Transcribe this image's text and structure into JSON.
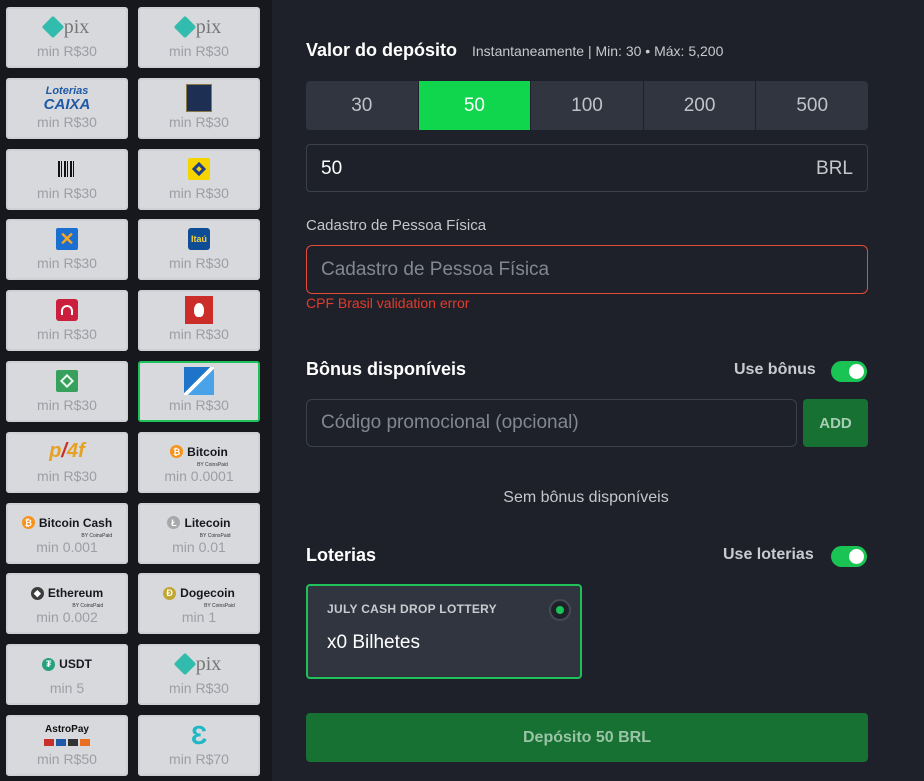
{
  "payment_methods": [
    {
      "name": "pix",
      "min": "min R$30",
      "logo": "pix-logo",
      "logo_text": "pix"
    },
    {
      "name": "pix",
      "min": "min R$30",
      "logo": "pix-logo",
      "logo_text": "pix"
    },
    {
      "name": "loterias-caixa",
      "min": "min R$30",
      "logo": "loterias-caixa-logo",
      "logo_text": "Loterias",
      "logo_text2": "CAIXA"
    },
    {
      "name": "safra",
      "min": "min R$30",
      "logo": "safra-logo"
    },
    {
      "name": "boleto",
      "min": "min R$30",
      "logo": "barcode-icon"
    },
    {
      "name": "banco-do-brasil",
      "min": "min R$30",
      "logo": "banco-do-brasil-logo"
    },
    {
      "name": "caixa",
      "min": "min R$30",
      "logo": "caixa-logo"
    },
    {
      "name": "itau",
      "min": "min R$30",
      "logo": "itau-logo",
      "logo_text": "Itaú"
    },
    {
      "name": "bradesco",
      "min": "min R$30",
      "logo": "bradesco-logo"
    },
    {
      "name": "santander",
      "min": "min R$30",
      "logo": "santander-logo"
    },
    {
      "name": "bank-transfer",
      "min": "min R$30",
      "logo": "green-box-icon"
    },
    {
      "name": "bank-transfer-2",
      "min": "min R$30",
      "logo": "blue-arrow-logo",
      "selected": true
    },
    {
      "name": "p24",
      "min": "min R$30",
      "logo": "p24-logo",
      "logo_text": "p",
      "logo_text2": "4f"
    },
    {
      "name": "bitcoin",
      "min": "min 0.0001",
      "logo": "bitcoin-icon",
      "logo_text": "Bitcoin",
      "badge": "CoinsPaid",
      "symbol": "₿",
      "color": "#f7931a"
    },
    {
      "name": "bitcoin-cash",
      "min": "min 0.001",
      "logo": "bitcoin-cash-icon",
      "logo_text": "Bitcoin Cash",
      "badge": "CoinsPaid",
      "symbol": "₿",
      "color": "#f7931a"
    },
    {
      "name": "litecoin",
      "min": "min 0.01",
      "logo": "litecoin-icon",
      "logo_text": "Litecoin",
      "badge": "CoinsPaid",
      "symbol": "Ł",
      "color": "#a6a9aa"
    },
    {
      "name": "ethereum",
      "min": "min 0.002",
      "logo": "ethereum-icon",
      "logo_text": "Ethereum",
      "badge": "CoinsPaid",
      "symbol": "◆",
      "color": "#3c3c3d"
    },
    {
      "name": "dogecoin",
      "min": "min 1",
      "logo": "dogecoin-icon",
      "logo_text": "Dogecoin",
      "badge": "CoinsPaid",
      "symbol": "Ð",
      "color": "#c2a633"
    },
    {
      "name": "usdt",
      "min": "min 5",
      "logo": "tether-icon",
      "logo_text": "USDT",
      "symbol": "₮",
      "color": "#26a17b"
    },
    {
      "name": "pix",
      "min": "min R$30",
      "logo": "pix-logo",
      "logo_text": "pix"
    },
    {
      "name": "astropay",
      "min": "min R$50",
      "logo": "astropay-logo",
      "logo_text": "AstroPay"
    },
    {
      "name": "e-wallet",
      "min": "min R$70",
      "logo": "e-wallet-logo"
    }
  ],
  "deposit": {
    "title": "Valor do depósito",
    "subtitle": "Instantaneamente | Min: 30 • Máx: 5,200",
    "amounts": [
      "30",
      "50",
      "100",
      "200",
      "500"
    ],
    "selected_amount": "50",
    "value": "50",
    "currency": "BRL"
  },
  "cpf": {
    "label": "Cadastro de Pessoa Física",
    "placeholder": "Cadastro de Pessoa Física",
    "error": "CPF Brasil validation error"
  },
  "bonus": {
    "title": "Bônus disponíveis",
    "toggle_label": "Use bônus",
    "toggle_on": true,
    "promo_placeholder": "Código promocional (opcional)",
    "add_label": "ADD",
    "empty_text": "Sem bônus disponíveis"
  },
  "lottery": {
    "title": "Loterias",
    "toggle_label": "Use loterias",
    "toggle_on": true,
    "card_name": "JULY CASH DROP LOTTERY",
    "tickets": "x0 Bilhetes"
  },
  "submit_label": "Depósito 50 BRL",
  "colors": {
    "accent": "#0fd64c",
    "button_dark_green": "#177133",
    "error": "#e33b2c",
    "panel_bg": "#1e2129",
    "sidebar_bg": "#16181e"
  }
}
